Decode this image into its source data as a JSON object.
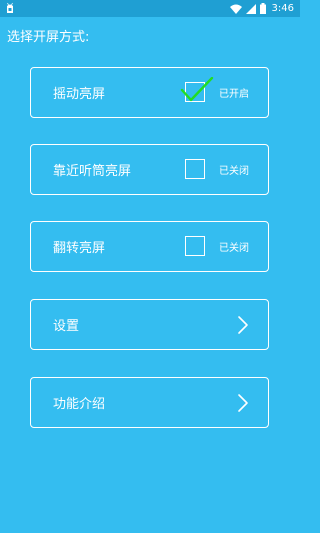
{
  "status_bar": {
    "time": "3:46",
    "left_icon": "android-notification-icon",
    "wifi_icon": "wifi-icon",
    "signal_icon": "cell-signal-icon",
    "battery_icon": "battery-icon"
  },
  "prompt": "选择开屏方式:",
  "options": [
    {
      "label": "摇动亮屏",
      "status": "已开启",
      "checked": true,
      "icon": "checkmark-icon",
      "check_color": "#22dd22"
    },
    {
      "label": "靠近听筒亮屏",
      "status": "已关闭",
      "checked": false
    },
    {
      "label": "翻转亮屏",
      "status": "已关闭",
      "checked": false
    }
  ],
  "nav_items": [
    {
      "label": "设置",
      "icon": "chevron-right-icon"
    },
    {
      "label": "功能介绍",
      "icon": "chevron-right-icon"
    }
  ],
  "colors": {
    "background": "#34bdf0",
    "status_bar": "#1f9fd3",
    "foreground": "#ffffff"
  }
}
